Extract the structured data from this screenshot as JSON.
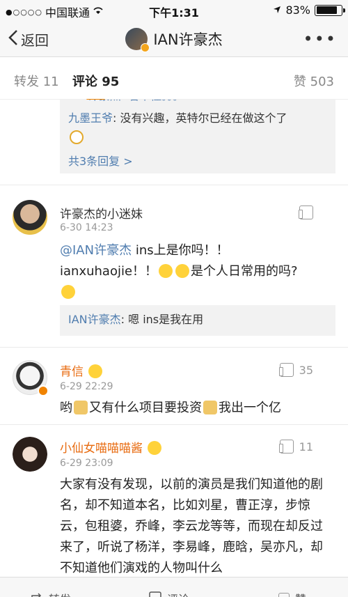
{
  "status": {
    "carrier": "中国联通",
    "time": "下午1:31",
    "battery_text": "83%",
    "battery_level": 0.83
  },
  "nav": {
    "back_label": "返回",
    "title": "IAN许豪杰"
  },
  "tabs": {
    "repost": "转发 11",
    "comments": "评论 95",
    "likes": "赞 503"
  },
  "first_reply_box": {
    "partial_line": "IAN许豪杰: 看不懂。。。",
    "reply_user": "九墨王爷",
    "reply_text": ": 没有兴趣，英特尔已经在做这个了",
    "more_replies": "共3条回复 >"
  },
  "comments": [
    {
      "username": "许豪杰的小迷妹",
      "time": "6-30 14:23",
      "mention": "@IAN许豪杰",
      "text_line1": " ins上是你吗！！",
      "text_line2a": "ianxuhaojie！！",
      "text_line2b": "是个人日常用的吗?",
      "reply_user": "IAN许豪杰",
      "reply_text": ": 嗯 ins是我在用"
    },
    {
      "username": "青信",
      "time": "6-29 22:29",
      "likes": "35",
      "text_a": "哟",
      "text_b": "又有什么项目要投资",
      "text_c": "我出一个亿"
    },
    {
      "username": "小仙女喵喵喵酱",
      "time": "6-29 23:09",
      "likes": "11",
      "text": "大家有没有发现，以前的演员是我们知道他的剧名，却不知道本名，比如刘星，曹正淳，步惊云，包租婆，乔峰，李云龙等等，而现在却反过来了，听说了杨洋，李易峰，鹿晗，吴亦凡，却不知道他们演戏的人物叫什么"
    }
  ],
  "bottom_bar": {
    "repost": "转发",
    "comment": "评论",
    "like": "赞"
  }
}
